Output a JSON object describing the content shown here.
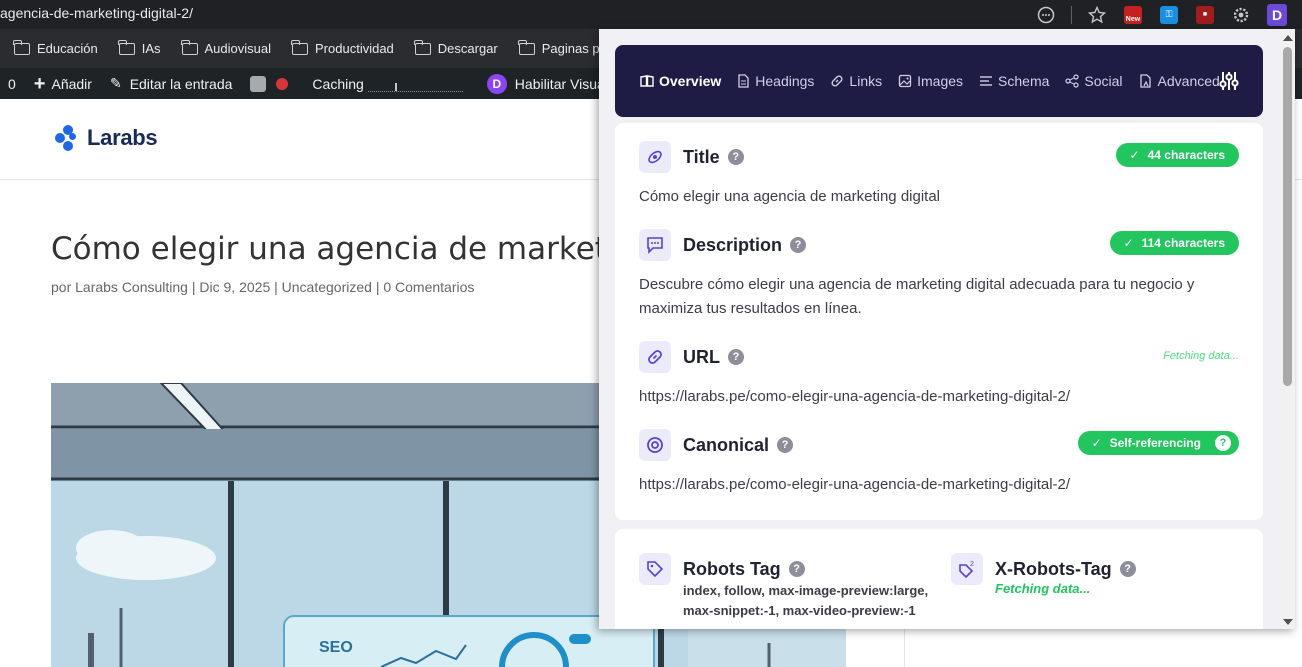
{
  "browser": {
    "url": "agencia-de-marketing-digital-2/",
    "extensions": [
      "extensions-icon",
      "bookmark-star-icon",
      "new-badge-icon",
      "key-icon",
      "ublock-icon",
      "gear-extension-icon",
      "detailed-seo-icon"
    ],
    "ext_new_label": "New",
    "ext_d_label": "D"
  },
  "bookmarks": [
    {
      "label": "Educación"
    },
    {
      "label": "IAs"
    },
    {
      "label": "Audiovisual"
    },
    {
      "label": "Productividad"
    },
    {
      "label": "Descargar"
    },
    {
      "label": "Paginas para bu"
    }
  ],
  "adminbar": {
    "count": "0",
    "add": "Añadir",
    "edit": "Editar la entrada",
    "caching": "Caching",
    "divi_logo": "D",
    "visual": "Habilitar Visua"
  },
  "site": {
    "logo": "Larabs",
    "post_title": "Cómo elegir una agencia de marketing d",
    "meta_prefix": "por ",
    "author": "Larabs Consulting",
    "sep": " | ",
    "date": "Dic 9, 2025",
    "category": "Uncategorized",
    "comments": "0 Comentarios",
    "hero_text": "SEO"
  },
  "popup": {
    "tabs": [
      {
        "label": "Overview",
        "icon": "book-icon",
        "active": true
      },
      {
        "label": "Headings",
        "icon": "document-icon"
      },
      {
        "label": "Links",
        "icon": "link-icon"
      },
      {
        "label": "Images",
        "icon": "image-icon"
      },
      {
        "label": "Schema",
        "icon": "list-icon"
      },
      {
        "label": "Social",
        "icon": "share-icon"
      },
      {
        "label": "Advanced",
        "icon": "advanced-icon"
      }
    ],
    "help": "?",
    "title": {
      "label": "Title",
      "value": "Cómo elegir una agencia de marketing digital",
      "badge": "44 characters"
    },
    "description": {
      "label": "Description",
      "value": "Descubre cómo elegir una agencia de marketing digital adecuada para tu negocio y maximiza tus resultados en línea.",
      "badge": "114 characters"
    },
    "url": {
      "label": "URL",
      "value": "https://larabs.pe/como-elegir-una-agencia-de-marketing-digital-2/",
      "status": "Fetching data..."
    },
    "canonical": {
      "label": "Canonical",
      "value": "https://larabs.pe/como-elegir-una-agencia-de-marketing-digital-2/",
      "badge": "Self-referencing"
    },
    "robots": {
      "label": "Robots Tag",
      "value": "index, follow, max-image-preview:large, max-snippet:-1, max-video-preview:-1"
    },
    "xrobots": {
      "label": "X-Robots-Tag",
      "value": "Fetching data..."
    },
    "check": "✓"
  },
  "colors": {
    "tab_bar": "#1e1b44",
    "badge_green": "#22c55e",
    "icon_purple": "#5b3fd8",
    "icon_bg": "#ecebfb"
  }
}
